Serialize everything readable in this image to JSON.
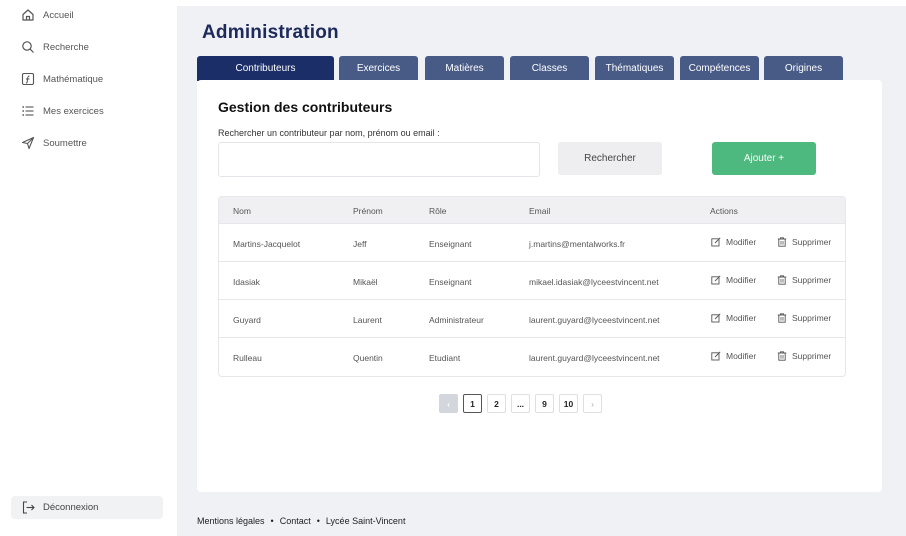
{
  "sidebar": {
    "items": [
      {
        "label": "Accueil",
        "icon": "home-icon"
      },
      {
        "label": "Recherche",
        "icon": "search-icon"
      },
      {
        "label": "Mathématique",
        "icon": "function-icon"
      },
      {
        "label": "Mes exercices",
        "icon": "list-icon"
      },
      {
        "label": "Soumettre",
        "icon": "send-icon"
      }
    ],
    "logout_label": "Déconnexion"
  },
  "main": {
    "title": "Administration",
    "tabs": [
      {
        "label": "Contributeurs",
        "active": true
      },
      {
        "label": "Exercices"
      },
      {
        "label": "Matières"
      },
      {
        "label": "Classes"
      },
      {
        "label": "Thématiques"
      },
      {
        "label": "Compétences"
      },
      {
        "label": "Origines"
      }
    ],
    "panel": {
      "title": "Gestion des contributeurs",
      "search_label": "Rechercher un contributeur par nom, prénom ou email :",
      "search_value": "",
      "search_button": "Rechercher",
      "add_button": "Ajouter +"
    },
    "table": {
      "columns": [
        "Nom",
        "Prénom",
        "Rôle",
        "Email",
        "Actions"
      ],
      "rows": [
        {
          "nom": "Martins-Jacquelot",
          "prenom": "Jeff",
          "role": "Enseignant",
          "email": "j.martins@mentalworks.fr"
        },
        {
          "nom": "Idasiak",
          "prenom": "Mikaël",
          "role": "Enseignant",
          "email": "mikael.idasiak@lyceestvincent.net"
        },
        {
          "nom": "Guyard",
          "prenom": "Laurent",
          "role": "Administrateur",
          "email": "laurent.guyard@lyceestvincent.net"
        },
        {
          "nom": "Rulleau",
          "prenom": "Quentin",
          "role": "Etudiant",
          "email": "laurent.guyard@lyceestvincent.net"
        }
      ],
      "modify_label": "Modifier",
      "delete_label": "Supprimer"
    },
    "pagination": {
      "prev": "‹",
      "pages": [
        "1",
        "2",
        "...",
        "9",
        "10"
      ],
      "current": "1",
      "next": "›"
    }
  },
  "footer": {
    "links": [
      "Mentions légales",
      "Contact",
      "Lycée Saint-Vincent"
    ]
  },
  "colors": {
    "accent": "#1b2e68",
    "tab": "#485a86",
    "add": "#4db97e",
    "background": "#eff1f5"
  }
}
